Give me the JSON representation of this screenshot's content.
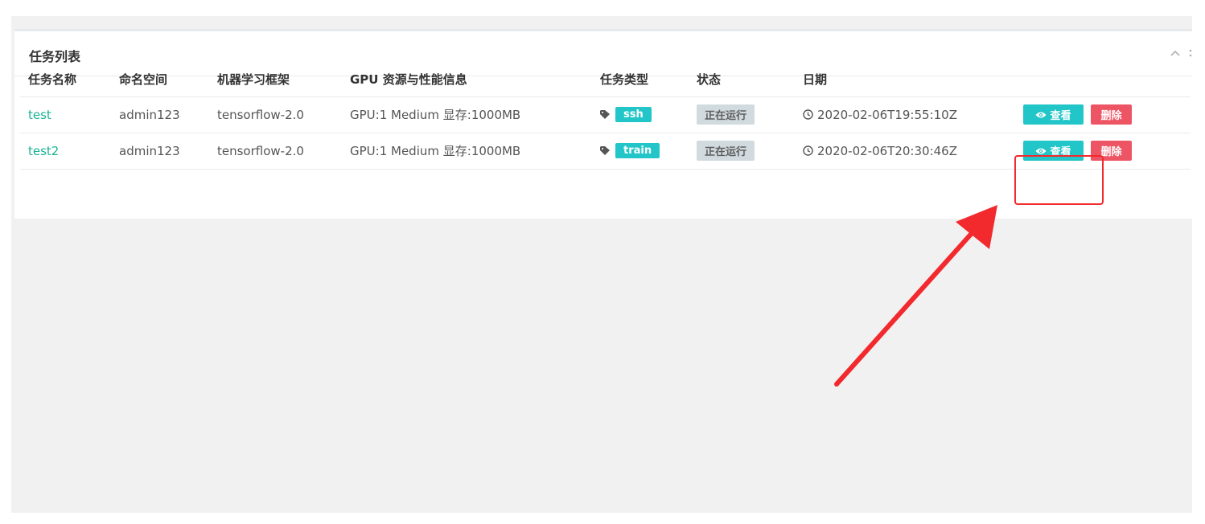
{
  "panel": {
    "title": "任务列表"
  },
  "table": {
    "headers": [
      "任务名称",
      "命名空间",
      "机器学习框架",
      "GPU 资源与性能信息",
      "任务类型",
      "状态",
      "日期",
      ""
    ],
    "rows": [
      {
        "name": "test",
        "namespace": "admin123",
        "framework": "tensorflow-2.0",
        "gpu_info": "GPU:1 Medium 显存:1000MB",
        "type": "ssh",
        "status": "正在运行",
        "date": "2020-02-06T19:55:10Z",
        "view_label": "查看",
        "delete_label": "删除"
      },
      {
        "name": "test2",
        "namespace": "admin123",
        "framework": "tensorflow-2.0",
        "gpu_info": "GPU:1 Medium 显存:1000MB",
        "type": "train",
        "status": "正在运行",
        "date": "2020-02-06T20:30:46Z",
        "view_label": "查看",
        "delete_label": "删除"
      }
    ]
  },
  "colors": {
    "link_green": "#1ab394",
    "info_cyan": "#23c6c8",
    "danger_red": "#ed5565",
    "annotation_red": "#f2292d"
  },
  "icons": {
    "tag": "tag-icon",
    "clock": "clock-icon",
    "eye": "eye-icon",
    "collapse": "chevron-up-icon",
    "more": "more-vertical-icon"
  }
}
